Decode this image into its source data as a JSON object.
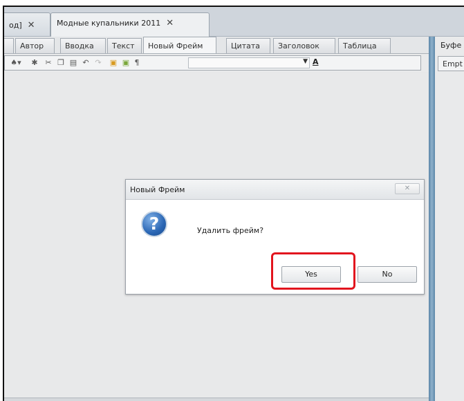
{
  "document_tabs": [
    {
      "label": "од]",
      "close": "✕"
    },
    {
      "label": "Модные купальники 2011",
      "close": "✕"
    }
  ],
  "format_tabs": [
    "",
    "Автор",
    "Вводка",
    "Текст",
    "Новый Фрейм",
    "Цитата",
    "Заголовок",
    "Таблица"
  ],
  "toolbar": {
    "format_letter": "A"
  },
  "right_panel": {
    "title": "Буфе",
    "value": "Empt"
  },
  "dialog": {
    "title": "Новый Фрейм",
    "icon_glyph": "?",
    "message": "Удалить фрейм?",
    "yes_label": "Yes",
    "no_label": "No"
  },
  "colors": {
    "highlight": "#e2141e",
    "splitter": "#5b86a8"
  }
}
